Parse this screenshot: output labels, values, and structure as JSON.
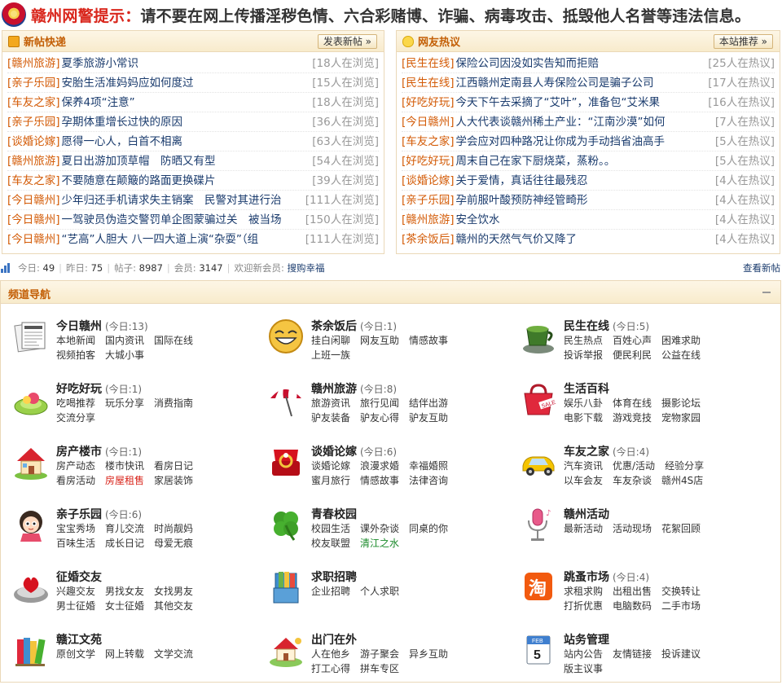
{
  "banner": {
    "title": "赣州网警提示：",
    "message": "请不要在网上传播淫秽色情、六合彩赌博、诈骗、病毒攻击、抵毁他人名誉等违法信息。"
  },
  "new_posts": {
    "title": "新帖快递",
    "button": "发表新帖 »",
    "items": [
      {
        "category": "[赣州旅游]",
        "title": "夏季旅游小常识",
        "count": "[18人在浏览]"
      },
      {
        "category": "[亲子乐园]",
        "title": "安胎生活准妈妈应如何度过",
        "count": "[15人在浏览]"
      },
      {
        "category": "[车友之家]",
        "title": "保养4项“注意”",
        "count": "[18人在浏览]"
      },
      {
        "category": "[亲子乐园]",
        "title": "孕期体重增长过快的原因",
        "count": "[36人在浏览]"
      },
      {
        "category": "[谈婚论嫁]",
        "title": "愿得一心人，白首不相离",
        "count": "[63人在浏览]"
      },
      {
        "category": "[赣州旅游]",
        "title": "夏日出游加顶草帽　防晒又有型",
        "count": "[54人在浏览]"
      },
      {
        "category": "[车友之家]",
        "title": "不要随意在颠簸的路面更换碟片",
        "count": "[39人在浏览]"
      },
      {
        "category": "[今日赣州]",
        "title": "少年归还手机请求失主销案　民警对其进行治",
        "count": "[111人在浏览]"
      },
      {
        "category": "[今日赣州]",
        "title": "一驾驶员伪造交警罚单企图蒙骗过关　被当场",
        "count": "[150人在浏览]"
      },
      {
        "category": "[今日赣州]",
        "title": "“艺高”人胆大 八一四大道上演“杂耍”（组",
        "count": "[111人在浏览]"
      }
    ]
  },
  "hot_topics": {
    "title": "网友热议",
    "button": "本站推荐 »",
    "items": [
      {
        "category": "[民生在线]",
        "title": "保险公司因没如实告知而拒赔",
        "count": "[25人在热议]"
      },
      {
        "category": "[民生在线]",
        "title": "江西赣州定南县人寿保险公司是骗子公司",
        "count": "[17人在热议]"
      },
      {
        "category": "[好吃好玩]",
        "title": "今天下午去采摘了“艾叶”，准备包“艾米果",
        "count": "[16人在热议]"
      },
      {
        "category": "[今日赣州]",
        "title": "人大代表谈赣州稀土产业：“江南沙漠”如何",
        "count": "[7人在热议]"
      },
      {
        "category": "[车友之家]",
        "title": "学会应对四种路况让你成为手动挡省油高手",
        "count": "[5人在热议]"
      },
      {
        "category": "[好吃好玩]",
        "title": "周末自己在家下厨烧菜，蒸粉。。",
        "count": "[5人在热议]"
      },
      {
        "category": "[谈婚论嫁]",
        "title": "关于爱情，真话往往最残忍",
        "count": "[4人在热议]"
      },
      {
        "category": "[亲子乐园]",
        "title": "孕前服叶酸预防神经管畸形",
        "count": "[4人在热议]"
      },
      {
        "category": "[赣州旅游]",
        "title": "安全饮水",
        "count": "[4人在热议]"
      },
      {
        "category": "[茶余饭后]",
        "title": "赣州的天然气气价又降了",
        "count": "[4人在热议]"
      }
    ]
  },
  "stats": {
    "today_label": "今日:",
    "today": "49",
    "yesterday_label": "昨日:",
    "yesterday": "75",
    "posts_label": "帖子:",
    "posts": "8987",
    "members_label": "会员:",
    "members": "3147",
    "welcome_label": "欢迎新会员:",
    "new_member": "搜购幸福",
    "view_new": "查看新帖"
  },
  "channels": {
    "title": "频道导航",
    "items": [
      {
        "name": "今日赣州",
        "today": "(今日:13)",
        "icon": "newspaper-icon",
        "links": [
          {
            "t": "本地新闻"
          },
          {
            "t": "国内资讯"
          },
          {
            "t": "国际在线"
          },
          {
            "t": "视频拍客"
          },
          {
            "t": "大城小事"
          }
        ]
      },
      {
        "name": "茶余饭后",
        "today": "(今日:1)",
        "icon": "laughing-face-icon",
        "links": [
          {
            "t": "挂白闲聊"
          },
          {
            "t": "网友互助"
          },
          {
            "t": "情感故事"
          },
          {
            "t": "上班一族"
          }
        ]
      },
      {
        "name": "民生在线",
        "today": "(今日:5)",
        "icon": "tea-cup-icon",
        "links": [
          {
            "t": "民生热点"
          },
          {
            "t": "百姓心声"
          },
          {
            "t": "困难求助"
          },
          {
            "t": "投诉举报"
          },
          {
            "t": "便民利民"
          },
          {
            "t": "公益在线"
          }
        ]
      },
      {
        "name": "好吃好玩",
        "today": "(今日:1)",
        "icon": "food-plate-icon",
        "links": [
          {
            "t": "吃喝推荐"
          },
          {
            "t": "玩乐分享"
          },
          {
            "t": "消费指南"
          },
          {
            "t": "交流分享"
          }
        ]
      },
      {
        "name": "赣州旅游",
        "today": "(今日:8)",
        "icon": "beach-umbrella-icon",
        "links": [
          {
            "t": "旅游资讯"
          },
          {
            "t": "旅行见闻"
          },
          {
            "t": "结伴出游"
          },
          {
            "t": "驴友装备"
          },
          {
            "t": "驴友心得"
          },
          {
            "t": "驴友互助"
          }
        ]
      },
      {
        "name": "生活百科",
        "today": "",
        "icon": "sale-bag-icon",
        "links": [
          {
            "t": "娱乐八卦"
          },
          {
            "t": "体育在线"
          },
          {
            "t": "摄影论坛"
          },
          {
            "t": "电影下载"
          },
          {
            "t": "游戏竞技"
          },
          {
            "t": "宠物家园"
          }
        ]
      },
      {
        "name": "房产楼市",
        "today": "(今日:1)",
        "icon": "house-icon",
        "links": [
          {
            "t": "房产动态"
          },
          {
            "t": "楼市快讯"
          },
          {
            "t": "看房日记"
          },
          {
            "t": "看房活动"
          },
          {
            "t": "房屋租售",
            "style": "red"
          },
          {
            "t": "家居装饰"
          }
        ]
      },
      {
        "name": "谈婚论嫁",
        "today": "(今日:6)",
        "icon": "ring-box-icon",
        "links": [
          {
            "t": "谈婚论嫁"
          },
          {
            "t": "浪漫求婚"
          },
          {
            "t": "幸福婚照"
          },
          {
            "t": "蜜月旅行"
          },
          {
            "t": "情感故事"
          },
          {
            "t": "法律咨询"
          }
        ]
      },
      {
        "name": "车友之家",
        "today": "(今日:4)",
        "icon": "car-icon",
        "links": [
          {
            "t": "汽车资讯"
          },
          {
            "t": "优惠/活动"
          },
          {
            "t": "经验分享"
          },
          {
            "t": "以车会友"
          },
          {
            "t": "车友杂谈"
          },
          {
            "t": "赣州4S店"
          }
        ]
      },
      {
        "name": "亲子乐园",
        "today": "(今日:6)",
        "icon": "child-icon",
        "links": [
          {
            "t": "宝宝秀场"
          },
          {
            "t": "育儿交流"
          },
          {
            "t": "时尚靓妈"
          },
          {
            "t": "百味生活"
          },
          {
            "t": "成长日记"
          },
          {
            "t": "母爱无痕"
          }
        ]
      },
      {
        "name": "青春校园",
        "today": "",
        "icon": "clover-icon",
        "links": [
          {
            "t": "校园生活"
          },
          {
            "t": "课外杂谈"
          },
          {
            "t": "同桌的你"
          },
          {
            "t": "校友联盟"
          },
          {
            "t": "清江之水",
            "style": "green"
          }
        ]
      },
      {
        "name": "赣州活动",
        "today": "",
        "icon": "microphone-icon",
        "links": [
          {
            "t": "最新活动"
          },
          {
            "t": "活动现场"
          },
          {
            "t": "花絮回顾"
          }
        ]
      },
      {
        "name": "征婚交友",
        "today": "",
        "icon": "heart-chair-icon",
        "links": [
          {
            "t": "兴趣交友"
          },
          {
            "t": "男找女友"
          },
          {
            "t": "女找男友"
          },
          {
            "t": "男士征婚"
          },
          {
            "t": "女士征婚"
          },
          {
            "t": "其他交友"
          }
        ]
      },
      {
        "name": "求职招聘",
        "today": "",
        "icon": "folder-icon",
        "links": [
          {
            "t": "企业招聘"
          },
          {
            "t": "个人求职"
          }
        ]
      },
      {
        "name": "跳蚤市场",
        "today": "(今日:4)",
        "icon": "taobao-icon",
        "links": [
          {
            "t": "求租求购"
          },
          {
            "t": "出租出售"
          },
          {
            "t": "交换转让"
          },
          {
            "t": "打折优惠"
          },
          {
            "t": "电脑数码"
          },
          {
            "t": "二手市场"
          }
        ]
      },
      {
        "name": "赣江文苑",
        "today": "",
        "icon": "books-icon",
        "links": [
          {
            "t": "原创文学"
          },
          {
            "t": "网上转载"
          },
          {
            "t": "文学交流"
          }
        ]
      },
      {
        "name": "出门在外",
        "today": "",
        "icon": "travel-house-icon",
        "links": [
          {
            "t": "人在他乡"
          },
          {
            "t": "游子聚会"
          },
          {
            "t": "异乡互助"
          },
          {
            "t": "打工心得"
          },
          {
            "t": "拼车专区"
          }
        ]
      },
      {
        "name": "站务管理",
        "today": "",
        "icon": "calendar-icon",
        "calendar_text": [
          "FEB",
          "5"
        ],
        "links": [
          {
            "t": "站内公告"
          },
          {
            "t": "友情链接"
          },
          {
            "t": "投诉建议"
          },
          {
            "t": "版主议事"
          }
        ]
      }
    ]
  }
}
